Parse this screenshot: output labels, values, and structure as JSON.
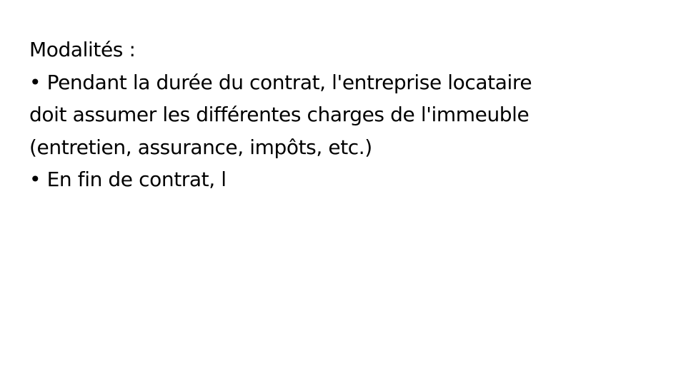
{
  "slide": {
    "heading": "Modalités :",
    "bullet_1": {
      "line_1": "• Pendant la durée du contrat, l'entreprise locataire",
      "line_2": "doit assumer les différentes charges de l'immeuble",
      "line_3": "(entretien, assurance, impôts, etc.)"
    },
    "bullet_2": {
      "line_1": "• En fin de contrat, l"
    }
  }
}
